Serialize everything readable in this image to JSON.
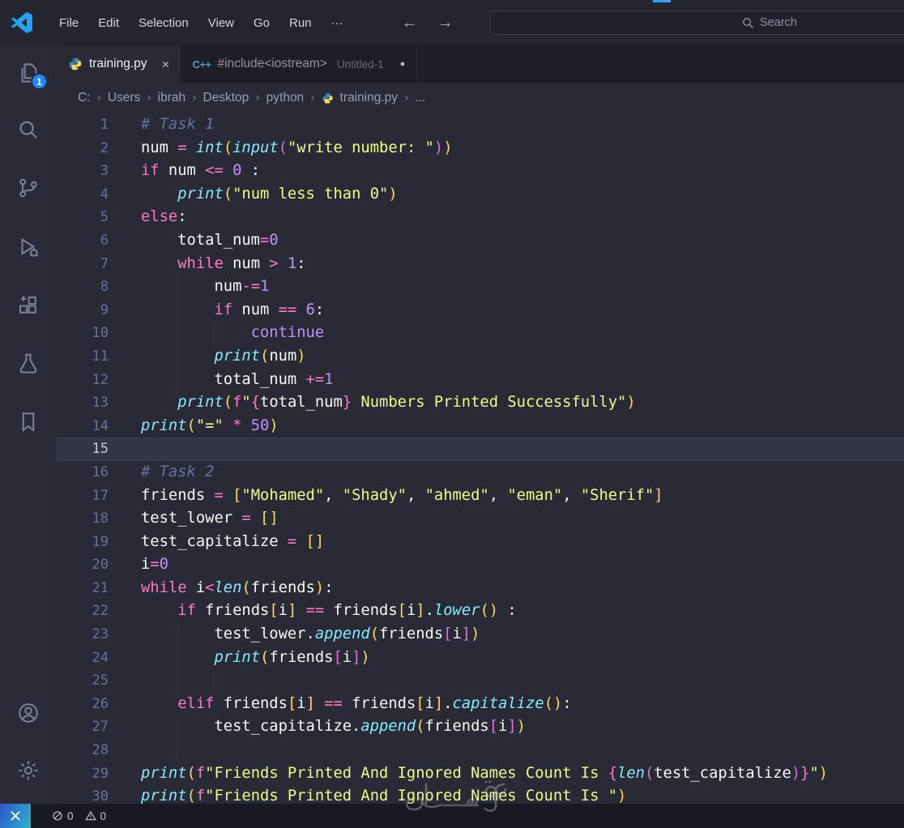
{
  "window": {
    "menus": [
      "File",
      "Edit",
      "Selection",
      "View",
      "Go",
      "Run",
      "···"
    ],
    "back_arrow": "←",
    "forward_arrow": "→",
    "search_placeholder": "Search"
  },
  "tabs": [
    {
      "name": "training.py",
      "type": "python",
      "close_glyph": "×"
    },
    {
      "name": "#include<iostream>",
      "desc": "Untitled-1",
      "type": "cpp",
      "dirty_dot": "●"
    }
  ],
  "breadcrumb": [
    "C:",
    "Users",
    "ibrah",
    "Desktop",
    "python",
    "training.py",
    "..."
  ],
  "ui": {
    "chevron": "›",
    "explorer_badge": "1"
  },
  "status": {
    "errors": "0",
    "warnings": "0"
  },
  "watermark": {
    "text": "حقستان"
  },
  "colors": {
    "editor_bg": "#282a36",
    "tabstrip_bg": "#1d1e27",
    "statusbar_bg": "#191a21",
    "badge_blue": "#2188ff",
    "keyword_pink": "#ff79c6",
    "builtin_cyan": "#8be9fd",
    "string_yellow": "#f1fa8c",
    "number_purple": "#bd93f9",
    "comment_gray": "#6272a4",
    "bracket_gold": "#ffd75e",
    "bracket_orchid": "#da70d6"
  },
  "editor": {
    "lines": [
      {
        "n": "1",
        "g": [],
        "t": [
          [
            "# Task 1",
            "com"
          ]
        ]
      },
      {
        "n": "2",
        "g": [],
        "t": [
          [
            "num ",
            "fg"
          ],
          [
            "=",
            "pink"
          ],
          [
            " ",
            "fg"
          ],
          [
            "int",
            "cyan"
          ],
          [
            "(",
            "b1"
          ],
          [
            "input",
            "cyan"
          ],
          [
            "(",
            "b2"
          ],
          [
            "\"write number: \"",
            "yel"
          ],
          [
            ")",
            "b2"
          ],
          [
            ")",
            "b1"
          ]
        ]
      },
      {
        "n": "3",
        "g": [],
        "t": [
          [
            "if",
            "pink"
          ],
          [
            " num ",
            "fg"
          ],
          [
            "<=",
            "pink"
          ],
          [
            " ",
            "fg"
          ],
          [
            "0",
            "pur"
          ],
          [
            " :",
            "fg"
          ]
        ]
      },
      {
        "n": "4",
        "g": [],
        "t": [
          [
            "    ",
            "fg"
          ],
          [
            "print",
            "cyan"
          ],
          [
            "(",
            "b1"
          ],
          [
            "\"num less than 0\"",
            "yel"
          ],
          [
            ")",
            "b1"
          ]
        ]
      },
      {
        "n": "5",
        "g": [],
        "t": [
          [
            "else",
            "pink"
          ],
          [
            ":",
            "fg"
          ]
        ]
      },
      {
        "n": "6",
        "g": [],
        "t": [
          [
            "    total_num",
            "fg"
          ],
          [
            "=",
            "pink"
          ],
          [
            "0",
            "pur"
          ]
        ]
      },
      {
        "n": "7",
        "g": [],
        "t": [
          [
            "    ",
            "fg"
          ],
          [
            "while",
            "pink"
          ],
          [
            " num ",
            "fg"
          ],
          [
            ">",
            "pink"
          ],
          [
            " ",
            "fg"
          ],
          [
            "1",
            "pur"
          ],
          [
            ":",
            "fg"
          ]
        ]
      },
      {
        "n": "8",
        "g": [
          4
        ],
        "t": [
          [
            "        num",
            "fg"
          ],
          [
            "-=",
            "pink"
          ],
          [
            "1",
            "pur"
          ]
        ]
      },
      {
        "n": "9",
        "g": [
          4
        ],
        "t": [
          [
            "        ",
            "fg"
          ],
          [
            "if",
            "pink"
          ],
          [
            " num ",
            "fg"
          ],
          [
            "==",
            "pink"
          ],
          [
            " ",
            "fg"
          ],
          [
            "6",
            "pur"
          ],
          [
            ":",
            "fg"
          ]
        ]
      },
      {
        "n": "10",
        "g": [
          4,
          8
        ],
        "t": [
          [
            "            ",
            "fg"
          ],
          [
            "continue",
            "pur"
          ]
        ]
      },
      {
        "n": "11",
        "g": [
          4
        ],
        "t": [
          [
            "        ",
            "fg"
          ],
          [
            "print",
            "cyan"
          ],
          [
            "(",
            "b1"
          ],
          [
            "num",
            "fg"
          ],
          [
            ")",
            "b1"
          ]
        ]
      },
      {
        "n": "12",
        "g": [
          4
        ],
        "t": [
          [
            "        total_num ",
            "fg"
          ],
          [
            "+=",
            "pink"
          ],
          [
            "1",
            "pur"
          ]
        ]
      },
      {
        "n": "13",
        "g": [],
        "t": [
          [
            "    ",
            "fg"
          ],
          [
            "print",
            "cyan"
          ],
          [
            "(",
            "b1"
          ],
          [
            "f",
            "pink"
          ],
          [
            "\"",
            "yel"
          ],
          [
            "{",
            "pink"
          ],
          [
            "total_num",
            "fg"
          ],
          [
            "}",
            "pink"
          ],
          [
            " Numbers Printed Successfully\"",
            "yel"
          ],
          [
            ")",
            "b1"
          ]
        ]
      },
      {
        "n": "14",
        "g": [],
        "t": [
          [
            "print",
            "cyan"
          ],
          [
            "(",
            "b1"
          ],
          [
            "\"=\"",
            "yel"
          ],
          [
            " ",
            "fg"
          ],
          [
            "*",
            "pink"
          ],
          [
            " ",
            "fg"
          ],
          [
            "50",
            "pur"
          ],
          [
            ")",
            "b1"
          ]
        ]
      },
      {
        "n": "15",
        "g": [],
        "cur": true,
        "t": []
      },
      {
        "n": "16",
        "g": [],
        "t": [
          [
            "# Task 2",
            "com"
          ]
        ]
      },
      {
        "n": "17",
        "g": [],
        "t": [
          [
            "friends ",
            "fg"
          ],
          [
            "=",
            "pink"
          ],
          [
            " ",
            "fg"
          ],
          [
            "[",
            "b1"
          ],
          [
            "\"Mohamed\"",
            "yel"
          ],
          [
            ", ",
            "fg"
          ],
          [
            "\"Shady\"",
            "yel"
          ],
          [
            ", ",
            "fg"
          ],
          [
            "\"ahmed\"",
            "yel"
          ],
          [
            ", ",
            "fg"
          ],
          [
            "\"eman\"",
            "yel"
          ],
          [
            ", ",
            "fg"
          ],
          [
            "\"Sherif\"",
            "yel"
          ],
          [
            "]",
            "b1"
          ]
        ]
      },
      {
        "n": "18",
        "g": [],
        "t": [
          [
            "test_lower ",
            "fg"
          ],
          [
            "=",
            "pink"
          ],
          [
            " ",
            "fg"
          ],
          [
            "[]",
            "b1"
          ]
        ]
      },
      {
        "n": "19",
        "g": [],
        "t": [
          [
            "test_capitalize ",
            "fg"
          ],
          [
            "=",
            "pink"
          ],
          [
            " ",
            "fg"
          ],
          [
            "[]",
            "b1"
          ]
        ]
      },
      {
        "n": "20",
        "g": [],
        "t": [
          [
            "i",
            "fg"
          ],
          [
            "=",
            "pink"
          ],
          [
            "0",
            "pur"
          ]
        ]
      },
      {
        "n": "21",
        "g": [],
        "t": [
          [
            "while",
            "pink"
          ],
          [
            " i",
            "fg"
          ],
          [
            "<",
            "pink"
          ],
          [
            "len",
            "cyan"
          ],
          [
            "(",
            "b1"
          ],
          [
            "friends",
            "fg"
          ],
          [
            ")",
            "b1"
          ],
          [
            ":",
            "fg"
          ]
        ]
      },
      {
        "n": "22",
        "g": [],
        "t": [
          [
            "    ",
            "fg"
          ],
          [
            "if",
            "pink"
          ],
          [
            " friends",
            "fg"
          ],
          [
            "[",
            "b1"
          ],
          [
            "i",
            "fg"
          ],
          [
            "]",
            "b1"
          ],
          [
            " ",
            "fg"
          ],
          [
            "==",
            "pink"
          ],
          [
            " friends",
            "fg"
          ],
          [
            "[",
            "b1"
          ],
          [
            "i",
            "fg"
          ],
          [
            "]",
            "b1"
          ],
          [
            ".",
            "fg"
          ],
          [
            "lower",
            "cyan"
          ],
          [
            "()",
            "b1"
          ],
          [
            " :",
            "fg"
          ]
        ]
      },
      {
        "n": "23",
        "g": [
          4
        ],
        "t": [
          [
            "        test_lower.",
            "fg"
          ],
          [
            "append",
            "cyan"
          ],
          [
            "(",
            "b1"
          ],
          [
            "friends",
            "fg"
          ],
          [
            "[",
            "b2"
          ],
          [
            "i",
            "fg"
          ],
          [
            "]",
            "b2"
          ],
          [
            ")",
            "b1"
          ]
        ]
      },
      {
        "n": "24",
        "g": [
          4
        ],
        "t": [
          [
            "        ",
            "fg"
          ],
          [
            "print",
            "cyan"
          ],
          [
            "(",
            "b1"
          ],
          [
            "friends",
            "fg"
          ],
          [
            "[",
            "b2"
          ],
          [
            "i",
            "fg"
          ],
          [
            "]",
            "b2"
          ],
          [
            ")",
            "b1"
          ]
        ]
      },
      {
        "n": "25",
        "g": [
          4,
          8
        ],
        "t": []
      },
      {
        "n": "26",
        "g": [],
        "t": [
          [
            "    ",
            "fg"
          ],
          [
            "elif",
            "pink"
          ],
          [
            " friends",
            "fg"
          ],
          [
            "[",
            "b1"
          ],
          [
            "i",
            "fg"
          ],
          [
            "]",
            "b1"
          ],
          [
            " ",
            "fg"
          ],
          [
            "==",
            "pink"
          ],
          [
            " friends",
            "fg"
          ],
          [
            "[",
            "b1"
          ],
          [
            "i",
            "fg"
          ],
          [
            "]",
            "b1"
          ],
          [
            ".",
            "fg"
          ],
          [
            "capitalize",
            "cyan"
          ],
          [
            "()",
            "b1"
          ],
          [
            ":",
            "fg"
          ]
        ]
      },
      {
        "n": "27",
        "g": [
          4
        ],
        "t": [
          [
            "        test_capitalize.",
            "fg"
          ],
          [
            "append",
            "cyan"
          ],
          [
            "(",
            "b1"
          ],
          [
            "friends",
            "fg"
          ],
          [
            "[",
            "b2"
          ],
          [
            "i",
            "fg"
          ],
          [
            "]",
            "b2"
          ],
          [
            ")",
            "b1"
          ]
        ]
      },
      {
        "n": "28",
        "g": [
          4
        ],
        "t": []
      },
      {
        "n": "29",
        "g": [],
        "t": [
          [
            "print",
            "cyan"
          ],
          [
            "(",
            "b1"
          ],
          [
            "f",
            "pink"
          ],
          [
            "\"Friends Printed And Ignored Names Count Is ",
            "yel"
          ],
          [
            "{",
            "pink"
          ],
          [
            "len",
            "cyan"
          ],
          [
            "(",
            "b2"
          ],
          [
            "test_capitalize",
            "fg"
          ],
          [
            ")",
            "b2"
          ],
          [
            "}",
            "pink"
          ],
          [
            "\"",
            "yel"
          ],
          [
            ")",
            "b1"
          ]
        ]
      },
      {
        "n": "30",
        "g": [],
        "t": [
          [
            "print",
            "cyan"
          ],
          [
            "(",
            "b1"
          ],
          [
            "f",
            "pink"
          ],
          [
            "\"Friends Printed And Ignored Names Count Is \"",
            "yel"
          ],
          [
            ")",
            "b1"
          ]
        ]
      }
    ]
  }
}
